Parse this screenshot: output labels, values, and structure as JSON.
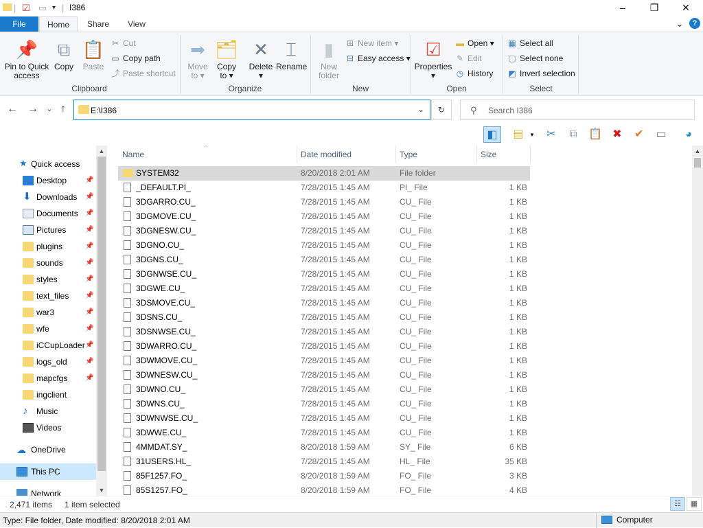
{
  "window": {
    "title": "I386",
    "minimize_glyph": "–",
    "maximize_glyph": "❐",
    "close_glyph": "✕",
    "quick_access_down": "▾"
  },
  "ribbon_tabs": [
    "File",
    "Home",
    "Share",
    "View"
  ],
  "ribbon": {
    "help_glyph": "?",
    "expand_glyph": "⌄",
    "groups": {
      "clipboard": "Clipboard",
      "organize": "Organize",
      "new": "New",
      "open": "Open",
      "select": "Select"
    },
    "pin_label_1": "Pin to Quick",
    "pin_label_2": "access",
    "copy_label": "Copy",
    "paste_label": "Paste",
    "cut_label": "Cut",
    "copy_path_label": "Copy path",
    "paste_shortcut_label": "Paste shortcut",
    "move_to_1": "Move",
    "move_to_2": "to ▾",
    "copy_to_1": "Copy",
    "copy_to_2": "to ▾",
    "delete_1": "Delete",
    "delete_2": "▾",
    "rename_label": "Rename",
    "new_folder_1": "New",
    "new_folder_2": "folder",
    "new_item_label": "New item ▾",
    "easy_access_label": "Easy access ▾",
    "properties_1": "Properties",
    "properties_2": "▾",
    "open_label": "Open ▾",
    "edit_label": "Edit",
    "history_label": "History",
    "select_all_label": "Select all",
    "select_none_label": "Select none",
    "invert_selection_label": "Invert selection"
  },
  "address": {
    "path": "E:\\I386",
    "search_placeholder": "Search I386",
    "back_glyph": "←",
    "forward_glyph": "→",
    "recent_glyph": "⌄",
    "up_glyph": "↑",
    "dropdown_glyph": "⌄",
    "refresh_glyph": "↻",
    "search_glyph": "⚲"
  },
  "nav": {
    "scroll_up": "▲",
    "scroll_down": "▼",
    "quick_access": "Quick access",
    "pinned": [
      {
        "label": "Desktop"
      },
      {
        "label": "Downloads"
      },
      {
        "label": "Documents"
      },
      {
        "label": "Pictures"
      },
      {
        "label": "plugins"
      },
      {
        "label": "sounds"
      },
      {
        "label": "styles"
      },
      {
        "label": "text_files"
      },
      {
        "label": "war3"
      },
      {
        "label": "wfe"
      },
      {
        "label": "iCCupLoader"
      },
      {
        "label": "logs_old"
      },
      {
        "label": "mapcfgs"
      },
      {
        "label": "ingclient"
      },
      {
        "label": "Music"
      },
      {
        "label": "Videos"
      }
    ],
    "onedrive": "OneDrive",
    "thispc": "This PC",
    "network": "Network"
  },
  "columns": {
    "name": "Name",
    "date": "Date modified",
    "type": "Type",
    "size": "Size"
  },
  "files": [
    {
      "name": "SYSTEM32",
      "date": "8/20/2018 2:01 AM",
      "type": "File folder",
      "size": "",
      "folder": true
    },
    {
      "name": "_DEFAULT.PI_",
      "date": "7/28/2015 1:45 AM",
      "type": "PI_ File",
      "size": "1 KB"
    },
    {
      "name": "3DGARRO.CU_",
      "date": "7/28/2015 1:45 AM",
      "type": "CU_ File",
      "size": "1 KB"
    },
    {
      "name": "3DGMOVE.CU_",
      "date": "7/28/2015 1:45 AM",
      "type": "CU_ File",
      "size": "1 KB"
    },
    {
      "name": "3DGNESW.CU_",
      "date": "7/28/2015 1:45 AM",
      "type": "CU_ File",
      "size": "1 KB"
    },
    {
      "name": "3DGNO.CU_",
      "date": "7/28/2015 1:45 AM",
      "type": "CU_ File",
      "size": "1 KB"
    },
    {
      "name": "3DGNS.CU_",
      "date": "7/28/2015 1:45 AM",
      "type": "CU_ File",
      "size": "1 KB"
    },
    {
      "name": "3DGNWSE.CU_",
      "date": "7/28/2015 1:45 AM",
      "type": "CU_ File",
      "size": "1 KB"
    },
    {
      "name": "3DGWE.CU_",
      "date": "7/28/2015 1:45 AM",
      "type": "CU_ File",
      "size": "1 KB"
    },
    {
      "name": "3DSMOVE.CU_",
      "date": "7/28/2015 1:45 AM",
      "type": "CU_ File",
      "size": "1 KB"
    },
    {
      "name": "3DSNS.CU_",
      "date": "7/28/2015 1:45 AM",
      "type": "CU_ File",
      "size": "1 KB"
    },
    {
      "name": "3DSNWSE.CU_",
      "date": "7/28/2015 1:45 AM",
      "type": "CU_ File",
      "size": "1 KB"
    },
    {
      "name": "3DWARRO.CU_",
      "date": "7/28/2015 1:45 AM",
      "type": "CU_ File",
      "size": "1 KB"
    },
    {
      "name": "3DWMOVE.CU_",
      "date": "7/28/2015 1:45 AM",
      "type": "CU_ File",
      "size": "1 KB"
    },
    {
      "name": "3DWNESW.CU_",
      "date": "7/28/2015 1:45 AM",
      "type": "CU_ File",
      "size": "1 KB"
    },
    {
      "name": "3DWNO.CU_",
      "date": "7/28/2015 1:45 AM",
      "type": "CU_ File",
      "size": "1 KB"
    },
    {
      "name": "3DWNS.CU_",
      "date": "7/28/2015 1:45 AM",
      "type": "CU_ File",
      "size": "1 KB"
    },
    {
      "name": "3DWNWSE.CU_",
      "date": "7/28/2015 1:45 AM",
      "type": "CU_ File",
      "size": "1 KB"
    },
    {
      "name": "3DWWE.CU_",
      "date": "7/28/2015 1:45 AM",
      "type": "CU_ File",
      "size": "1 KB"
    },
    {
      "name": "4MMDAT.SY_",
      "date": "8/20/2018 1:59 AM",
      "type": "SY_ File",
      "size": "6 KB"
    },
    {
      "name": "31USERS.HL_",
      "date": "7/28/2015 1:45 AM",
      "type": "HL_ File",
      "size": "35 KB"
    },
    {
      "name": "85F1257.FO_",
      "date": "8/20/2018 1:59 AM",
      "type": "FO_ File",
      "size": "3 KB"
    },
    {
      "name": "85S1257.FO_",
      "date": "8/20/2018 1:59 AM",
      "type": "FO_ File",
      "size": "4 KB"
    }
  ],
  "status": {
    "count": "2,471 items",
    "selected": "1 item selected",
    "details_view_glyph": "☷",
    "tiles_view_glyph": "▦"
  },
  "infobar": {
    "text": "Type: File folder, Date modified: 8/20/2018 2:01 AM",
    "location": "Computer"
  },
  "colors": {
    "accent": "#1979ca",
    "folder": "#f8d775",
    "selected_row": "#d9d9d9",
    "nav_selected": "#cce8ff"
  }
}
